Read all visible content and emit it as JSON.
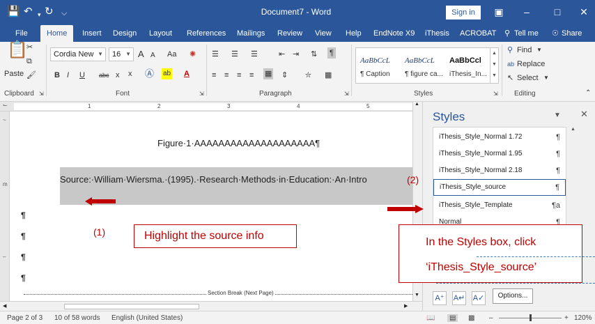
{
  "titlebar": {
    "title": "Document7  -  Word",
    "signin": "Sign in"
  },
  "tabs": [
    {
      "label": "File"
    },
    {
      "label": "Home"
    },
    {
      "label": "Insert"
    },
    {
      "label": "Design"
    },
    {
      "label": "Layout"
    },
    {
      "label": "References"
    },
    {
      "label": "Mailings"
    },
    {
      "label": "Review"
    },
    {
      "label": "View"
    },
    {
      "label": "Help"
    },
    {
      "label": "EndNote X9"
    },
    {
      "label": "iThesis"
    },
    {
      "label": "ACROBAT"
    },
    {
      "label": "Tell me"
    },
    {
      "label": "Share"
    }
  ],
  "ribbon": {
    "paste": "Paste",
    "font_name": "Cordia New",
    "font_size": "16",
    "font_grow": "A",
    "font_shrink": "A",
    "change_case": "Aa",
    "bold": "B",
    "italic": "I",
    "underline": "U",
    "strike": "abc",
    "subscript": "x",
    "superscript": "x",
    "groups": {
      "clipboard": "Clipboard",
      "font": "Font",
      "paragraph": "Paragraph",
      "styles": "Styles",
      "editing": "Editing"
    },
    "gallery": [
      {
        "sample": "AaBbCcL",
        "caption": "¶ Caption"
      },
      {
        "sample": "AaBbCcL",
        "caption": "¶ figure ca..."
      },
      {
        "sample": "AaBbCcl",
        "caption": "iThesis_In..."
      }
    ],
    "find": "Find",
    "replace": "Replace",
    "select": "Select"
  },
  "ruler": {
    "numbers": [
      "1",
      "2",
      "3",
      "4",
      "5"
    ]
  },
  "document": {
    "figure_title": "Figure·1·AAAAAAAAAAAAAAAAAAAA¶",
    "source_text": "Source:·William·Wiersma.·(1995).·Research·Methods·in·Education:·An·Intro",
    "pilcrow": "¶",
    "section_break": "Section Break (Next Page)"
  },
  "styles_pane": {
    "title": "Styles",
    "items": [
      {
        "name": "iThesis_Style_Normal 1.72",
        "mark": "¶"
      },
      {
        "name": "iThesis_Style_Normal 1.95",
        "mark": "¶"
      },
      {
        "name": "iThesis_Style_Normal 2.18",
        "mark": "¶"
      },
      {
        "name": "iThesis_Style_source",
        "mark": "¶"
      },
      {
        "name": "iThesis_Style_Template",
        "mark": "¶a"
      },
      {
        "name": "Normal",
        "mark": "¶"
      }
    ],
    "options": "Options..."
  },
  "statusbar": {
    "page": "Page 2 of 3",
    "words": "10 of 58 words",
    "language": "English (United States)",
    "zoom": "120%"
  },
  "annotations": {
    "step1": "(1)",
    "step2": "(2)",
    "callout1": "Highlight the source info",
    "callout2_line1": "In the Styles box, click",
    "callout2_line2": "‘iThesis_Style_source’"
  },
  "colors": {
    "brand": "#2b579a",
    "annotation": "#c00000",
    "highlight": "#c8c8c8"
  }
}
